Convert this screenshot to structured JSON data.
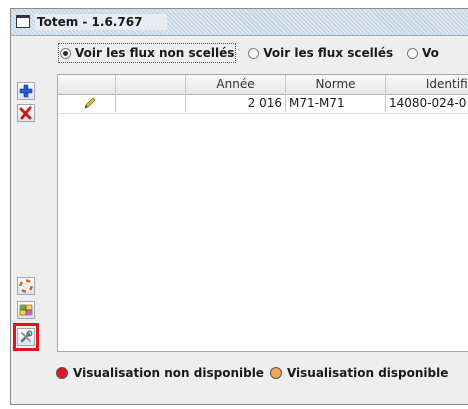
{
  "window": {
    "title": "Totem - 1.6.767"
  },
  "filters": {
    "options": [
      {
        "label": "Voir les flux non scellés",
        "selected": true
      },
      {
        "label": "Voir les flux scellés",
        "selected": false
      },
      {
        "label": "Vo",
        "selected": false
      }
    ]
  },
  "toolbar": {
    "top": [
      {
        "name": "add-icon",
        "color": "#2a5bd7"
      },
      {
        "name": "delete-icon",
        "color": "#d01b1b"
      }
    ],
    "bottom": [
      {
        "name": "lifebuoy-icon"
      },
      {
        "name": "grid-icon"
      },
      {
        "name": "tools-icon",
        "highlight": "#e0141e"
      }
    ]
  },
  "table": {
    "columns": [
      "",
      "",
      "Année",
      "Norme",
      "Identifia"
    ],
    "rows": [
      {
        "edit_icon": "pencil-icon",
        "blank": "",
        "annee": "2 016",
        "norme": "M71-M71",
        "identifiant": "14080-024-0"
      }
    ]
  },
  "legend": {
    "items": [
      {
        "label": "Visualisation non disponible",
        "color": "#d91b1b"
      },
      {
        "label": "Visualisation disponible",
        "color": "#f2a35a"
      }
    ]
  }
}
